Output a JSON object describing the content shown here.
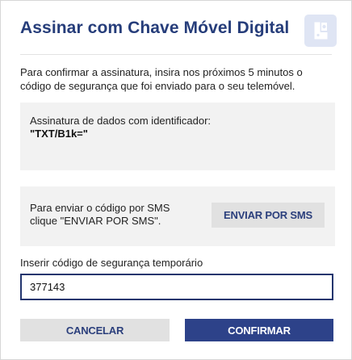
{
  "dialog": {
    "title": "Assinar com Chave Móvel Digital",
    "icon": "chave-movel-digital-icon",
    "intro": "Para confirmar a assinatura, insira nos próximos 5 minutos o código de segurança que foi enviado para o seu telemóvel."
  },
  "data_box": {
    "label": "Assinatura de dados com identificador:",
    "identifier": "\"TXT/B1k=\""
  },
  "sms_box": {
    "text": "Para enviar o código por SMS clique \"ENVIAR POR SMS\".",
    "button_label": "ENVIAR POR SMS"
  },
  "code": {
    "label": "Inserir código de segurança temporário",
    "value": "377143"
  },
  "actions": {
    "cancel_label": "CANCELAR",
    "confirm_label": "CONFIRMAR"
  },
  "colors": {
    "title": "#263d7a",
    "primary": "#2d4289",
    "secondary_bg": "#e1e1e1",
    "panel_bg": "#f2f2f2",
    "icon_bg": "#dfe5f4"
  }
}
